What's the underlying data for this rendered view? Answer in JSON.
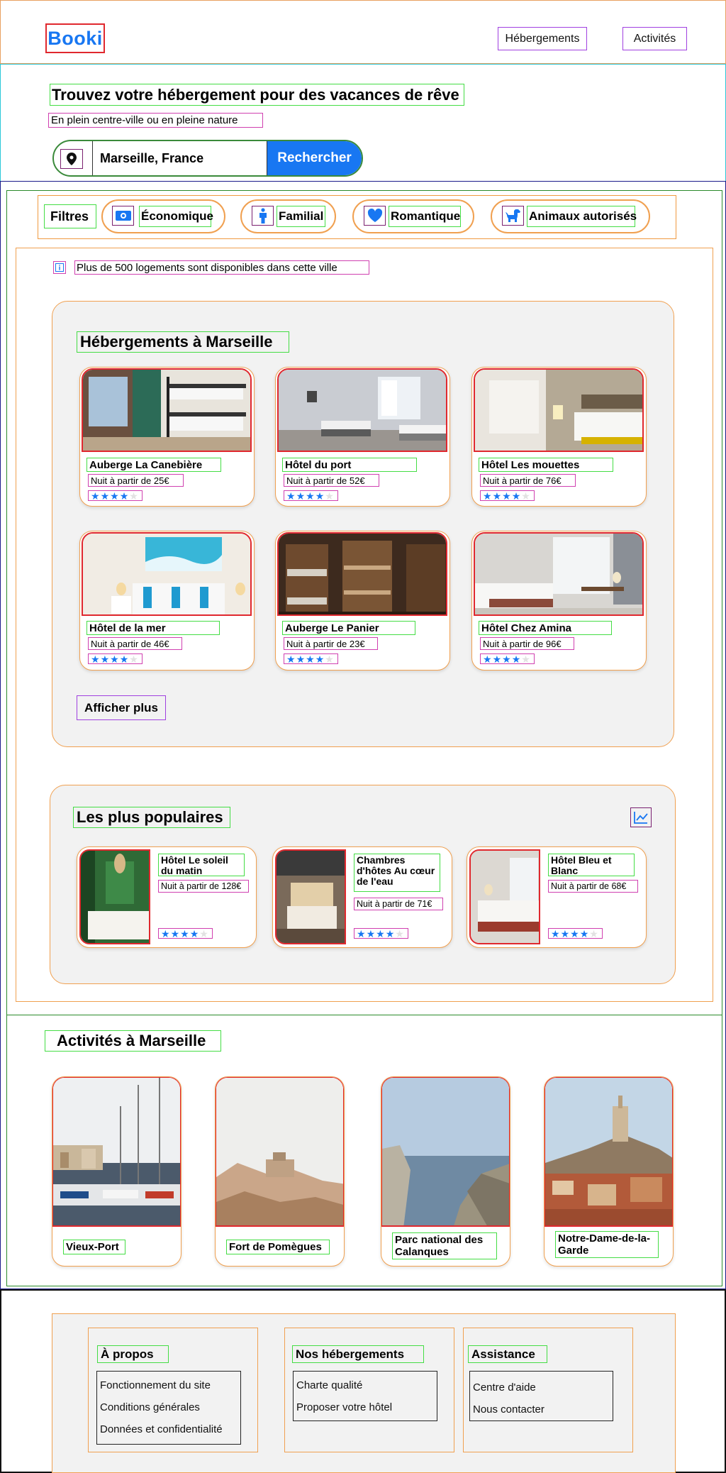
{
  "header": {
    "logo": "Booki",
    "nav": [
      "Hébergements",
      "Activités"
    ]
  },
  "search": {
    "title": "Trouvez votre hébergement pour des vacances de rêve",
    "subtitle": "En plein centre-ville ou en pleine nature",
    "location_value": "Marseille, France",
    "button": "Rechercher",
    "location_icon": "map-pin-icon"
  },
  "filters": {
    "label": "Filtres",
    "chips": [
      {
        "label": "Économique",
        "icon": "money-icon"
      },
      {
        "label": "Familial",
        "icon": "person-icon"
      },
      {
        "label": "Romantique",
        "icon": "heart-icon"
      },
      {
        "label": "Animaux autorisés",
        "icon": "dog-icon"
      }
    ]
  },
  "info": {
    "text": "Plus de 500 logements sont disponibles dans cette ville",
    "icon": "info-icon"
  },
  "accommodations": {
    "title": "Hébergements à Marseille",
    "items": [
      {
        "name": "Auberge La Canebière",
        "price": "Nuit à partir de 25€",
        "rating": 4
      },
      {
        "name": "Hôtel du port",
        "price": "Nuit à partir de 52€",
        "rating": 4
      },
      {
        "name": "Hôtel Les mouettes",
        "price": "Nuit à partir de 76€",
        "rating": 4
      },
      {
        "name": "Hôtel de la mer",
        "price": "Nuit à partir de 46€",
        "rating": 4
      },
      {
        "name": "Auberge Le Panier",
        "price": "Nuit à partir de 23€",
        "rating": 4
      },
      {
        "name": "Hôtel Chez Amina",
        "price": "Nuit à partir de 96€",
        "rating": 4
      }
    ],
    "more_button": "Afficher plus"
  },
  "popular": {
    "title": "Les plus populaires",
    "icon": "trend-chart-icon",
    "items": [
      {
        "name": "Hôtel Le soleil du matin",
        "price": "Nuit à partir de 128€",
        "rating": 4
      },
      {
        "name": "Chambres d'hôtes Au cœur de l'eau",
        "price": "Nuit à partir de 71€",
        "rating": 4
      },
      {
        "name": "Hôtel Bleu et Blanc",
        "price": "Nuit à partir de 68€",
        "rating": 4
      }
    ]
  },
  "activities": {
    "title": "Activités à Marseille",
    "items": [
      {
        "name": "Vieux-Port"
      },
      {
        "name": "Fort de Pomègues"
      },
      {
        "name": "Parc national des Calanques"
      },
      {
        "name": "Notre-Dame-de-la-Garde"
      }
    ]
  },
  "footer": {
    "columns": [
      {
        "title": "À propos",
        "links": [
          "Fonctionnement du site",
          "Conditions générales",
          "Données et confidentialité"
        ]
      },
      {
        "title": "Nos hébergements",
        "links": [
          "Charte qualité",
          "Proposer votre hôtel"
        ]
      },
      {
        "title": "Assistance",
        "links": [
          "Centre d'aide",
          "Nous contacter"
        ]
      }
    ]
  },
  "colors": {
    "brand": "#1877f2",
    "accent_border": "#f0a050",
    "panel_bg": "#f2f2f2"
  }
}
